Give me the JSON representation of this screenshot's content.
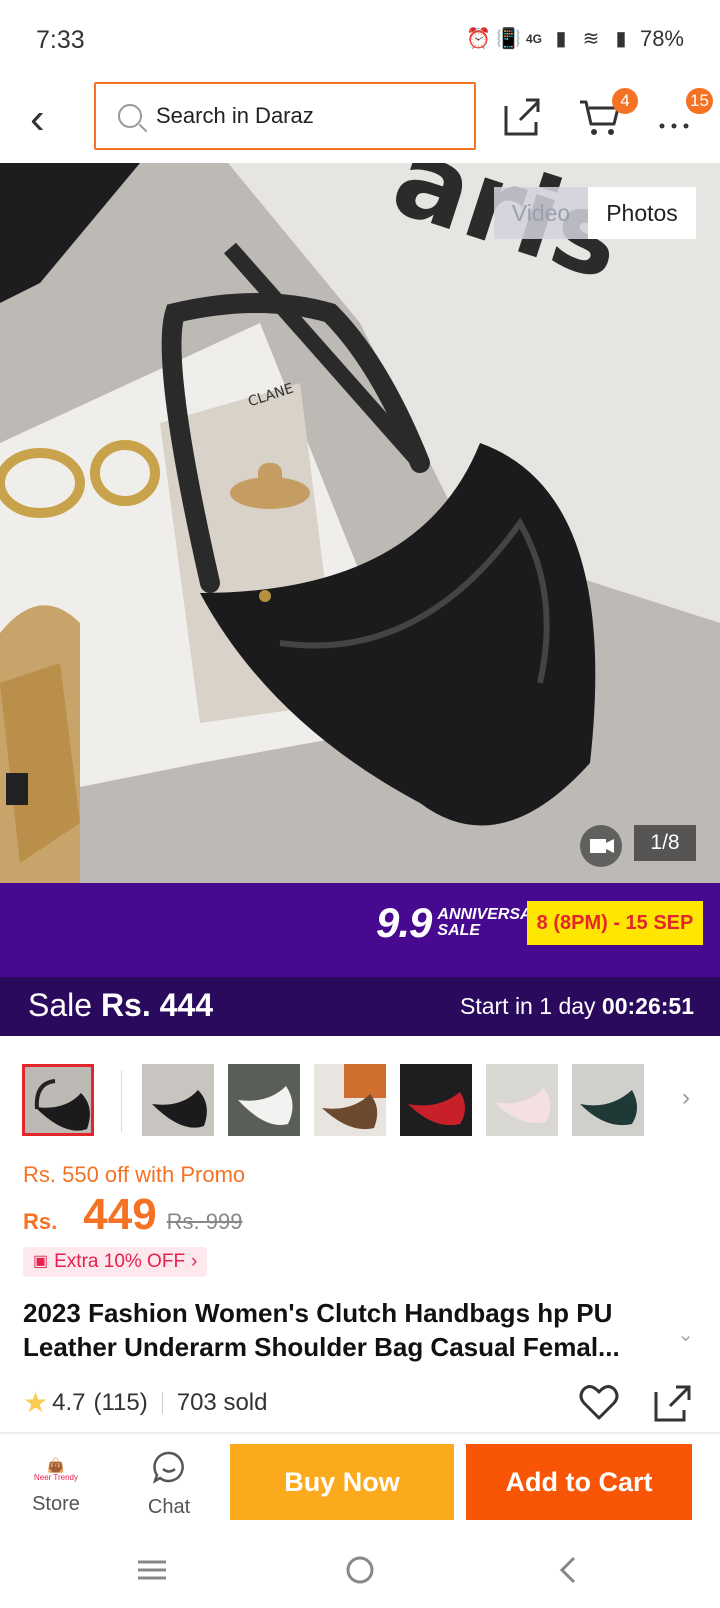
{
  "status_bar": {
    "time": "7:33",
    "battery": "78%",
    "network": "4G"
  },
  "header": {
    "search_placeholder": "Search in Daraz",
    "cart_count": "4",
    "more_count": "15"
  },
  "gallery": {
    "tab_video": "Video",
    "tab_photos": "Photos",
    "counter": "1/8",
    "image_caption": "CLANE"
  },
  "campaign": {
    "number": "9.9",
    "label_line1": "ANNIVERSARY",
    "label_line2": "SALE",
    "dates": "8 (8PM) - 15 SEP"
  },
  "sale_bar": {
    "sale_label": "Sale",
    "sale_price": "Rs. 444",
    "start_prefix": "Start in",
    "start_days": "1",
    "start_unit": "day",
    "countdown": "00:26:51"
  },
  "product": {
    "promo_text": "Rs. 550 off with Promo",
    "currency": "Rs.",
    "price": "449",
    "original_price": "Rs. 999",
    "extra_discount": "Extra 10% OFF",
    "title": "2023 Fashion Women's Clutch Handbags hp PU Leather Underarm Shoulder Bag Casual Femal...",
    "rating": "4.7",
    "reviews": "(115)",
    "sold": "703 sold"
  },
  "bottom_bar": {
    "store_label": "Store",
    "store_logo_text": "Neer Trendy",
    "chat_label": "Chat",
    "buy_now_label": "Buy Now",
    "add_to_cart_label": "Add to Cart"
  },
  "colors": {
    "accent": "#f57224",
    "buy_now": "#fbaa1d",
    "add_to_cart": "#f85606",
    "campaign_bg": "#46098f",
    "sale_bar_bg": "#2a0a5c"
  }
}
